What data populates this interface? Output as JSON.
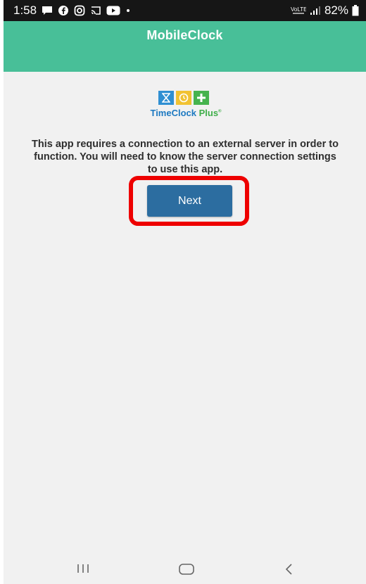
{
  "status_bar": {
    "time": "1:58",
    "battery": "82%",
    "notification_icons": [
      "message-icon",
      "facebook-icon",
      "instagram-icon",
      "cast-icon",
      "youtube-icon",
      "dot-icon"
    ]
  },
  "app_bar": {
    "title": "MobileClock"
  },
  "logo": {
    "brand": "TimeClock",
    "brand_accent": "Plus",
    "trademark": "®"
  },
  "intro_text": "This app requires a connection to an external server in order to function. You will need to know the server connection settings to use this app.",
  "next_button": {
    "label": "Next"
  },
  "colors": {
    "app_bar": "#48bf98",
    "button": "#2c6da0",
    "highlight": "#ee0000",
    "background": "#f1f1f1"
  }
}
